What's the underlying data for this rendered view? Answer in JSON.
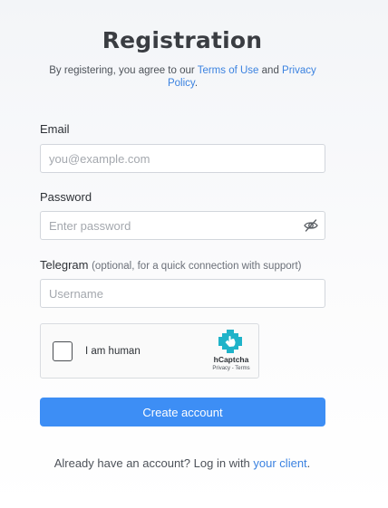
{
  "page": {
    "title": "Registration"
  },
  "terms": {
    "prefix": "By registering, you agree to our ",
    "terms_link": "Terms of Use",
    "middle": " and ",
    "privacy_link": "Privacy Policy",
    "suffix": "."
  },
  "form": {
    "email": {
      "label": "Email",
      "placeholder": "you@example.com",
      "value": ""
    },
    "password": {
      "label": "Password",
      "placeholder": "Enter password",
      "value": "",
      "toggle_icon": "eye-slash-icon"
    },
    "telegram": {
      "label": "Telegram",
      "hint": "(optional, for a quick connection with support)",
      "placeholder": "Username",
      "value": ""
    },
    "submit_label": "Create account"
  },
  "captcha": {
    "label": "I am human",
    "brand": "hCaptcha",
    "privacy_link": "Privacy",
    "separator": " - ",
    "terms_link": "Terms",
    "checked": false,
    "logo_icon": "hcaptcha-logo-icon"
  },
  "footer": {
    "prefix": "Already have an account? Log in with ",
    "link": "your client",
    "suffix": "."
  },
  "colors": {
    "accent": "#3d8ef5",
    "link": "#3b82e0",
    "captcha_logo": "#1fb3c9"
  }
}
